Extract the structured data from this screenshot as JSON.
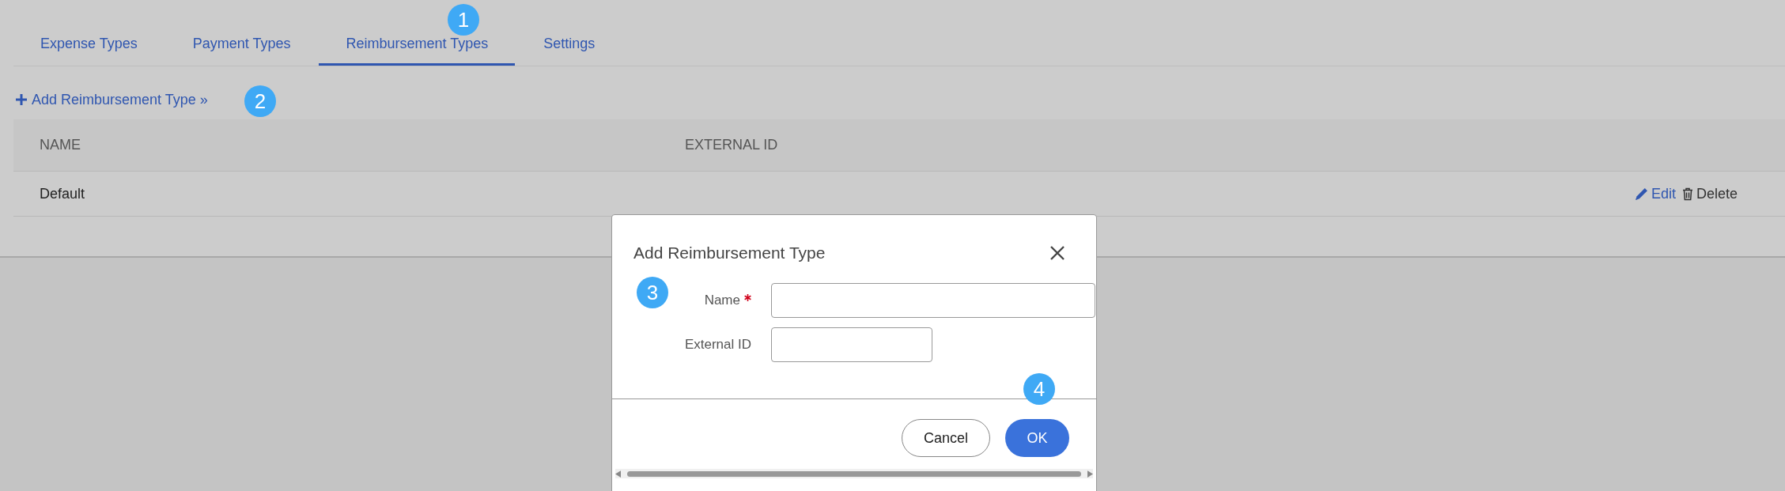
{
  "tabs": [
    {
      "label": "Expense Types",
      "selected": false
    },
    {
      "label": "Payment Types",
      "selected": false
    },
    {
      "label": "Reimbursement Types",
      "selected": true
    },
    {
      "label": "Settings",
      "selected": false
    }
  ],
  "add_link": "Add Reimbursement Type »",
  "table": {
    "columns": [
      "NAME",
      "EXTERNAL ID"
    ],
    "rows": [
      {
        "name": "Default",
        "actions": [
          {
            "label": "Edit",
            "kind": "edit"
          },
          {
            "label": "Delete",
            "kind": "delete"
          }
        ]
      }
    ]
  },
  "dialog": {
    "title": "Add Reimbursement Type",
    "fields": [
      {
        "label": "Name",
        "required": true
      },
      {
        "label": "External ID",
        "required": false
      }
    ],
    "buttons": [
      {
        "label": "Cancel",
        "kind": "secondary"
      },
      {
        "label": "OK",
        "kind": "primary"
      }
    ]
  },
  "callouts": [
    "1",
    "2",
    "3",
    "4"
  ]
}
